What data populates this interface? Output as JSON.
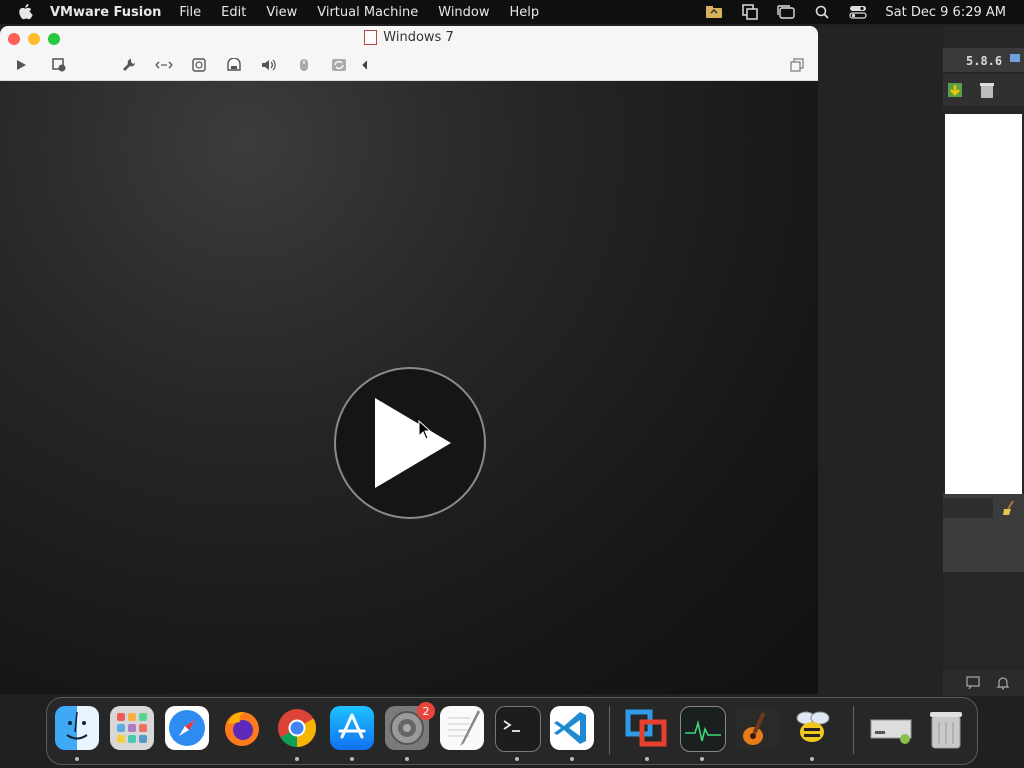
{
  "menubar": {
    "app_name": "VMware Fusion",
    "items": [
      "File",
      "Edit",
      "View",
      "Virtual Machine",
      "Window",
      "Help"
    ],
    "clock": "Sat Dec 9  6:29 AM",
    "status_icons": [
      "vmware-folder-icon",
      "screen-mirror-icon",
      "window-icon",
      "search-icon",
      "control-center-icon"
    ]
  },
  "window": {
    "title": "Windows 7",
    "toolbar_icons": [
      "play-icon",
      "snapshot-icon",
      "wrench-icon",
      "network-icon",
      "disk-icon",
      "printer-icon",
      "sound-icon",
      "usb-icon",
      "sync-icon",
      "chevron-left-icon",
      "fullscreen-icon"
    ]
  },
  "background_window": {
    "version": "5.8.6"
  },
  "dock": {
    "apps": [
      {
        "name": "Finder",
        "icon": "finder-icon",
        "running": true
      },
      {
        "name": "Launchpad",
        "icon": "launchpad-icon",
        "running": false
      },
      {
        "name": "Safari",
        "icon": "safari-icon",
        "running": false
      },
      {
        "name": "Firefox",
        "icon": "firefox-icon",
        "running": false
      },
      {
        "name": "Chrome",
        "icon": "chrome-icon",
        "running": true
      },
      {
        "name": "App Store",
        "icon": "app-store-icon",
        "running": true
      },
      {
        "name": "System Preferences",
        "icon": "settings-icon",
        "running": true,
        "badge": "2"
      },
      {
        "name": "TextEdit",
        "icon": "textedit-icon",
        "running": false
      },
      {
        "name": "Terminal",
        "icon": "terminal-icon",
        "running": true
      },
      {
        "name": "VS Code",
        "icon": "vscode-icon",
        "running": true
      },
      {
        "name": "VMware Fusion",
        "icon": "vmware-icon",
        "running": true
      },
      {
        "name": "Activity Monitor",
        "icon": "activity-monitor-icon",
        "running": true
      },
      {
        "name": "GarageBand",
        "icon": "garageband-icon",
        "running": false
      },
      {
        "name": "Bee",
        "icon": "bee-icon",
        "running": true
      },
      {
        "name": "Storage",
        "icon": "storage-icon",
        "running": false
      },
      {
        "name": "Trash",
        "icon": "trash-icon",
        "running": false
      }
    ]
  }
}
